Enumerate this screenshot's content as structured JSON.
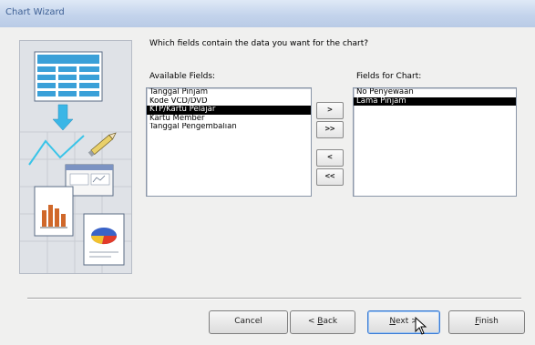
{
  "window": {
    "title": "Chart Wizard"
  },
  "prompt": "Which fields contain the data you want for the chart?",
  "available_fields": {
    "label": "Available Fields:",
    "items": [
      {
        "text": "Tanggal Pinjam",
        "selected": false
      },
      {
        "text": "Kode VCD/DVD",
        "selected": false
      },
      {
        "text": "KTP/Kartu Pelajar",
        "selected": true
      },
      {
        "text": "Kartu Member",
        "selected": false
      },
      {
        "text": "Tanggal Pengembalian",
        "selected": false
      }
    ]
  },
  "chart_fields": {
    "label": "Fields for Chart:",
    "items": [
      {
        "text": "No Penyewaan",
        "selected": false
      },
      {
        "text": "Lama Pinjam",
        "selected": true
      }
    ]
  },
  "move_buttons": {
    "add": ">",
    "add_all": ">>",
    "remove": "<",
    "remove_all": "<<"
  },
  "footer": {
    "cancel": "Cancel",
    "back": {
      "prefix": "< ",
      "mnemonic": "B",
      "rest": "ack"
    },
    "next": {
      "prefix": "",
      "mnemonic": "N",
      "rest": "ext >"
    },
    "finish": {
      "prefix": "",
      "mnemonic": "F",
      "rest": "inish"
    }
  },
  "colors": {
    "selection": "#000000",
    "titlebar": "#c4d4ec",
    "title_text": "#3d5f94"
  }
}
